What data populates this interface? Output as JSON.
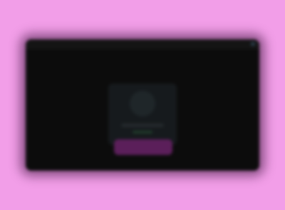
{
  "window": {
    "title": ""
  },
  "card": {
    "heading": "",
    "subtext": ""
  },
  "action": {
    "label": ""
  },
  "colors": {
    "background": "#f29ee8",
    "window": "#0e0e0e",
    "card": "#161a1d",
    "button": "#5b1f5a"
  }
}
